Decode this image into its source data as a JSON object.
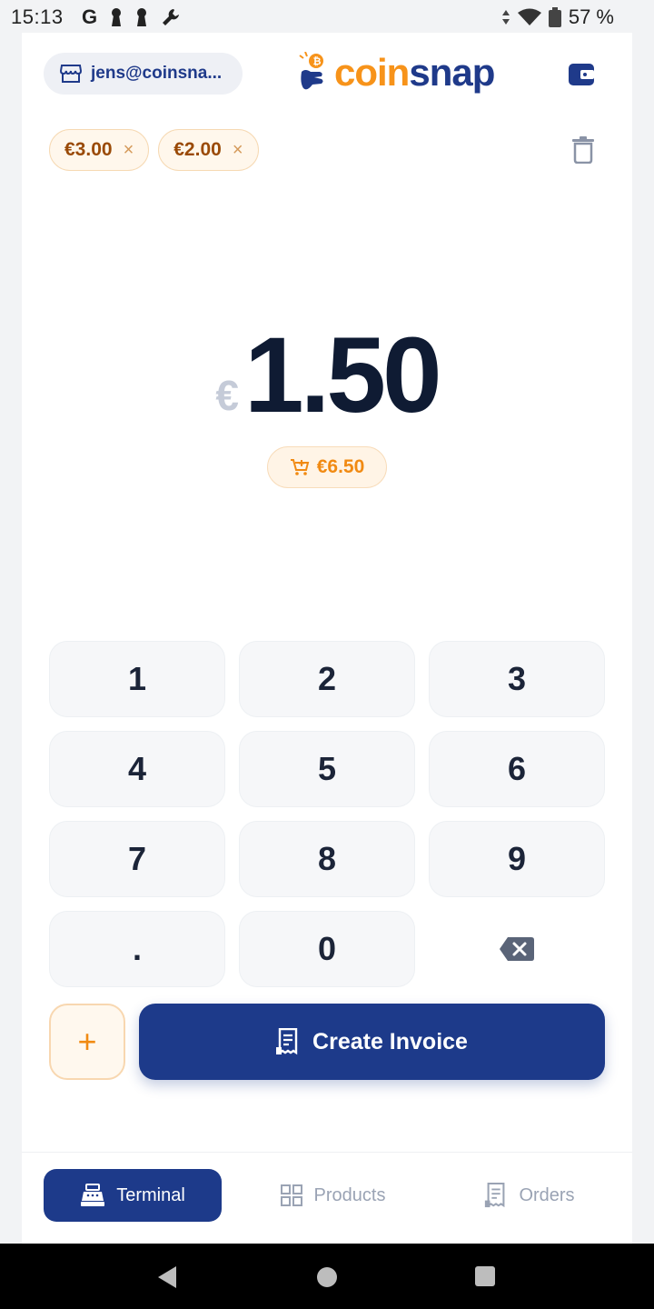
{
  "status_bar": {
    "time": "15:13",
    "google": "G",
    "battery": "57 %"
  },
  "header": {
    "account": "jens@coinsna...",
    "logo_coin": "coin",
    "logo_snap": "snap"
  },
  "chips": [
    {
      "label": "€3.00",
      "close": "×"
    },
    {
      "label": "€2.00",
      "close": "×"
    }
  ],
  "amount": {
    "currency": "€",
    "value": "1.50"
  },
  "cart_total": "€6.50",
  "keypad": {
    "k1": "1",
    "k2": "2",
    "k3": "3",
    "k4": "4",
    "k5": "5",
    "k6": "6",
    "k7": "7",
    "k8": "8",
    "k9": "9",
    "kdot": ".",
    "k0": "0"
  },
  "actions": {
    "add": "+",
    "create_invoice": "Create Invoice"
  },
  "nav": {
    "terminal": "Terminal",
    "products": "Products",
    "orders": "Orders"
  },
  "colors": {
    "primary": "#1d3a8a",
    "accent": "#f18a12"
  },
  "icons": [
    "store-icon",
    "coinsnap-logo-icon",
    "wallet-icon",
    "close-icon",
    "trash-icon",
    "cart-icon",
    "backspace-icon",
    "receipt-icon",
    "cash-register-icon",
    "grid-icon",
    "orders-icon"
  ]
}
